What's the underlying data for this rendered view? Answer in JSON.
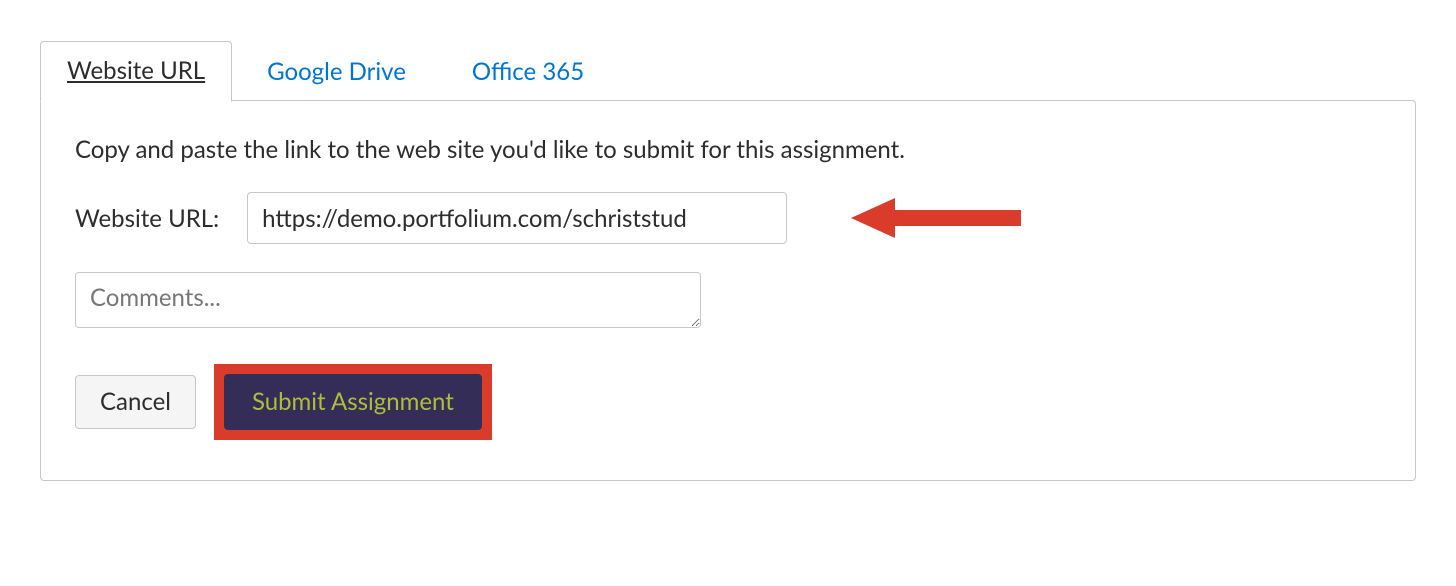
{
  "tabs": {
    "website_url": "Website URL",
    "google_drive": "Google Drive",
    "office_365": "Office 365"
  },
  "instructions": "Copy and paste the link to the web site you'd like to submit for this assignment.",
  "url_field": {
    "label": "Website URL:",
    "value": "https://demo.portfolium.com/schriststud"
  },
  "comments": {
    "placeholder": "Comments..."
  },
  "buttons": {
    "cancel": "Cancel",
    "submit": "Submit Assignment"
  },
  "annotation": {
    "arrow_color": "#d93c2b",
    "highlight_color": "#d93c2b"
  }
}
